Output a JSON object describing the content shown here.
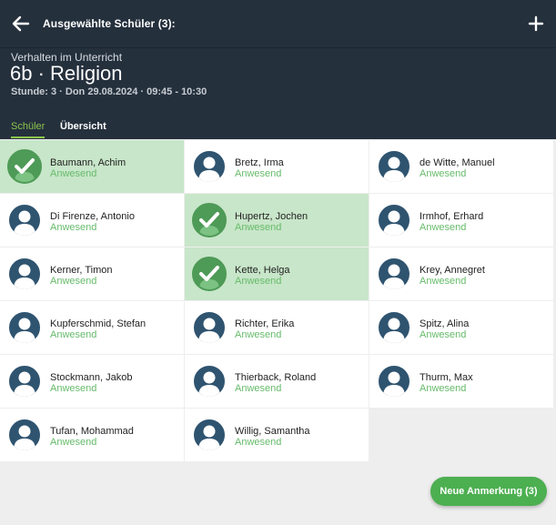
{
  "topbar": {
    "title": "Ausgewählte Schüler (3):"
  },
  "header": {
    "subtitle": "Verhalten im Unterricht",
    "title": "6b · Religion",
    "meta": "Stunde: 3 · Don 29.08.2024 · 09:45 - 10:30"
  },
  "tabs": [
    {
      "label": "Schüler",
      "active": true
    },
    {
      "label": "Übersicht",
      "active": false
    }
  ],
  "students": [
    {
      "name": "Baumann, Achim",
      "status": "Anwesend",
      "selected": true
    },
    {
      "name": "Bretz, Irma",
      "status": "Anwesend",
      "selected": false
    },
    {
      "name": "de Witte, Manuel",
      "status": "Anwesend",
      "selected": false
    },
    {
      "name": "Di Firenze, Antonio",
      "status": "Anwesend",
      "selected": false
    },
    {
      "name": "Hupertz, Jochen",
      "status": "Anwesend",
      "selected": true
    },
    {
      "name": "Irmhof, Erhard",
      "status": "Anwesend",
      "selected": false
    },
    {
      "name": "Kerner, Timon",
      "status": "Anwesend",
      "selected": false
    },
    {
      "name": "Kette, Helga",
      "status": "Anwesend",
      "selected": true
    },
    {
      "name": "Krey, Annegret",
      "status": "Anwesend",
      "selected": false
    },
    {
      "name": "Kupferschmid, Stefan",
      "status": "Anwesend",
      "selected": false
    },
    {
      "name": "Richter, Erika",
      "status": "Anwesend",
      "selected": false
    },
    {
      "name": "Spitz, Alina",
      "status": "Anwesend",
      "selected": false
    },
    {
      "name": "Stockmann, Jakob",
      "status": "Anwesend",
      "selected": false
    },
    {
      "name": "Thierback, Roland",
      "status": "Anwesend",
      "selected": false
    },
    {
      "name": "Thurm, Max",
      "status": "Anwesend",
      "selected": false
    },
    {
      "name": "Tufan, Mohammad",
      "status": "Anwesend",
      "selected": false
    },
    {
      "name": "Willig, Samantha",
      "status": "Anwesend",
      "selected": false
    }
  ],
  "fab": {
    "label": "Neue Anmerkung (3)"
  },
  "colors": {
    "header_bg": "#25303d",
    "accent_green": "#8bc34a",
    "selected_bg": "#c8e6c9",
    "status_green": "#66bb6a",
    "fab_bg": "#4caf50",
    "avatar_bg": "#2f5470"
  },
  "icons": {
    "back": "arrow-left-icon",
    "add": "plus-icon",
    "avatar": "person-silhouette-icon",
    "selected": "check-icon"
  }
}
